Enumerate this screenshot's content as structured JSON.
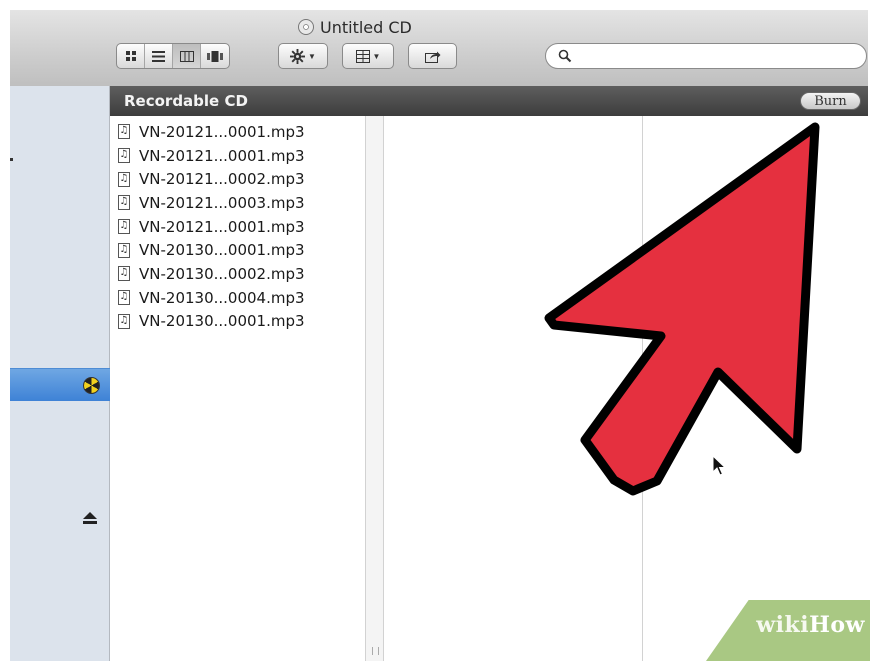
{
  "window": {
    "title": "Untitled CD"
  },
  "toolbar": {
    "view_buttons": [
      "icon-view",
      "list-view",
      "column-view",
      "cover-flow-view"
    ],
    "search": {
      "placeholder": "",
      "value": ""
    }
  },
  "header_strip": {
    "label": "Recordable CD",
    "burn_label": "Burn"
  },
  "files": [
    "VN-20121...0001.mp3",
    "VN-20121...0001.mp3",
    "VN-20121...0002.mp3",
    "VN-20121...0003.mp3",
    "VN-20121...0001.mp3",
    "VN-20130...0001.mp3",
    "VN-20130...0002.mp3",
    "VN-20130...0004.mp3",
    "VN-20130...0001.mp3"
  ],
  "watermark": {
    "part1": "wiki",
    "part2": "How"
  },
  "colors": {
    "arrow_fill": "#e5303f",
    "arrow_outline": "#000000",
    "sidebar_selection": "#3e82d6",
    "watermark_bg": "#a9c883"
  }
}
